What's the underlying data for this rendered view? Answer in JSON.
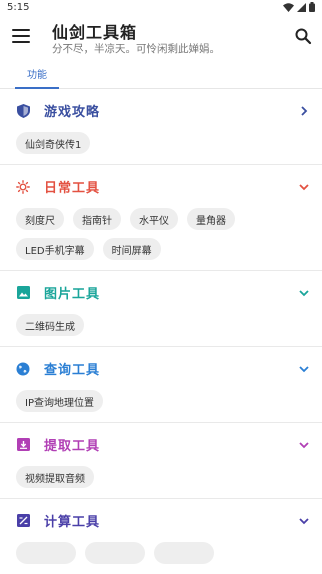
{
  "status": {
    "time": "5:15"
  },
  "appbar": {
    "title": "仙剑工具箱",
    "subtitle": "分不尽，半凉天。可怜闲剩此婵娟。"
  },
  "tabs": [
    {
      "label": "功能"
    }
  ],
  "colors": {
    "accent": "#3a6fc7"
  },
  "sections": [
    {
      "title": "游戏攻略",
      "color": "#3a4fa0",
      "icon": "shield-icon",
      "chevron": "right",
      "chips": [
        "仙剑奇侠传1"
      ]
    },
    {
      "title": "日常工具",
      "color": "#e35141",
      "icon": "sun-icon",
      "chevron": "down",
      "chips": [
        "刻度尺",
        "指南针",
        "水平仪",
        "量角器",
        "LED手机字幕",
        "时间屏幕"
      ]
    },
    {
      "title": "图片工具",
      "color": "#1aa59a",
      "icon": "image-icon",
      "chevron": "down",
      "chips": [
        "二维码生成"
      ]
    },
    {
      "title": "查询工具",
      "color": "#2b7fd4",
      "icon": "globe-icon",
      "chevron": "down",
      "chips": [
        "IP查询地理位置"
      ]
    },
    {
      "title": "提取工具",
      "color": "#b13fb5",
      "icon": "download-box-icon",
      "chevron": "down",
      "chips": [
        "视频提取音频"
      ]
    },
    {
      "title": "计算工具",
      "color": "#4a3fa8",
      "icon": "calculator-icon",
      "chevron": "down",
      "chips": []
    }
  ]
}
